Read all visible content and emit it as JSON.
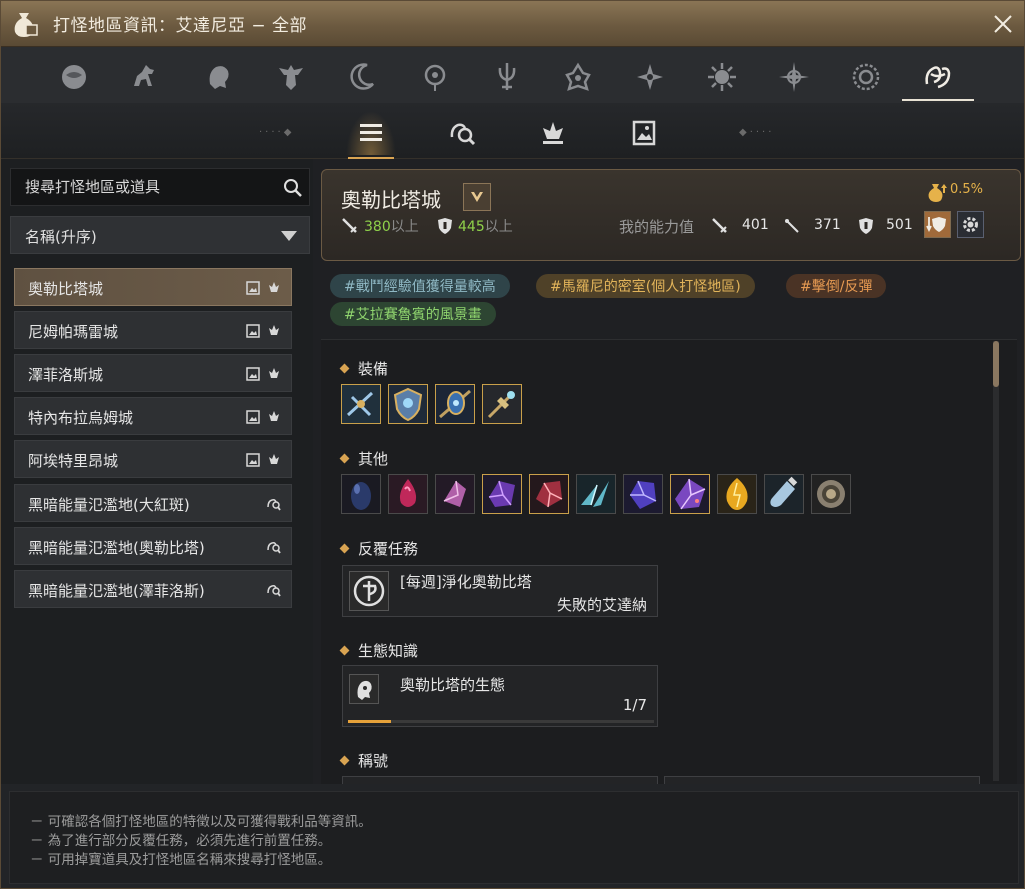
{
  "window": {
    "title": "打怪地區資訊：艾達尼亞 − 全部"
  },
  "region_tabs": [
    {
      "icon": "orb-emblem-icon"
    },
    {
      "icon": "horse-emblem-icon"
    },
    {
      "icon": "lion-emblem-icon"
    },
    {
      "icon": "eagle-emblem-icon"
    },
    {
      "icon": "crescent-emblem-icon"
    },
    {
      "icon": "eye-emblem-icon"
    },
    {
      "icon": "trident-emblem-icon"
    },
    {
      "icon": "flower-emblem-icon"
    },
    {
      "icon": "compass-emblem-icon"
    },
    {
      "icon": "sun-emblem-icon"
    },
    {
      "icon": "star-emblem-icon"
    },
    {
      "icon": "ring-emblem-icon"
    },
    {
      "icon": "all-regions-emblem-icon",
      "active": true
    }
  ],
  "sub_tabs": [
    {
      "icon": "list-icon",
      "active": true
    },
    {
      "icon": "monster-search-icon"
    },
    {
      "icon": "dungeon-crown-icon"
    },
    {
      "icon": "painting-icon"
    }
  ],
  "sidebar": {
    "search_placeholder": "搜尋打怪地區或道具",
    "sort_label": "名稱(升序)",
    "items": [
      {
        "name": "奧勒比塔城",
        "icons": [
          "painting-icon",
          "dungeon-crown-icon"
        ],
        "active": true
      },
      {
        "name": "尼姆帕瑪雷城",
        "icons": [
          "painting-icon",
          "dungeon-crown-icon"
        ]
      },
      {
        "name": "澤菲洛斯城",
        "icons": [
          "painting-icon",
          "dungeon-crown-icon"
        ]
      },
      {
        "name": "特內布拉烏姆城",
        "icons": [
          "painting-icon",
          "dungeon-crown-icon"
        ]
      },
      {
        "name": "阿埃特里昂城",
        "icons": [
          "painting-icon",
          "dungeon-crown-icon"
        ]
      },
      {
        "name": "黑暗能量氾濫地(大紅斑)",
        "icons": [
          "monster-search-icon"
        ]
      },
      {
        "name": "黑暗能量氾濫地(奧勒比塔)",
        "icons": [
          "monster-search-icon"
        ]
      },
      {
        "name": "黑暗能量氾濫地(澤菲洛斯)",
        "icons": [
          "monster-search-icon"
        ]
      }
    ]
  },
  "detail": {
    "name": "奧勒比塔城",
    "attack_req_value": "380",
    "attack_req_suffix": "以上",
    "defense_req_value": "445",
    "defense_req_suffix": "以上",
    "bonus": "0.5%",
    "my_stats_label": "我的能力值",
    "my_attack": "401",
    "my_accuracy": "371",
    "my_defense": "501",
    "tags": [
      {
        "text": "#戰鬥經驗值獲得量較高",
        "style": "teal"
      },
      {
        "text": "#馬羅尼的密室(個人打怪地區)",
        "style": "gold"
      },
      {
        "text": "#擊倒/反彈",
        "style": "orange"
      },
      {
        "text": "#艾拉賽魯賓的風景畫",
        "style": "green"
      }
    ],
    "sections": {
      "equipment_title": "裝備",
      "other_title": "其他",
      "repeat_quest_title": "反覆任務",
      "ecology_title": "生態知識",
      "title_title": "稱號"
    },
    "equipment_items": [
      "crossbow-item-icon",
      "shield-item-icon",
      "ornament-item-icon",
      "orb-staff-item-icon"
    ],
    "other_items": [
      "dark-egg-item-icon",
      "red-gem-item-icon",
      "pink-crystal-item-icon",
      "purple-crystal-item-icon",
      "red-crystal-item-icon",
      "teal-shard-item-icon",
      "violet-gem-item-icon",
      "amethyst-item-icon",
      "gold-egg-item-icon",
      "potion-item-icon",
      "medal-item-icon"
    ],
    "repeat_quest": {
      "title": "[每週]淨化奧勒比塔",
      "npc": "失敗的艾達納"
    },
    "ecology": {
      "title": "奧勒比塔的生態",
      "progress_text": "1/7",
      "progress": 0.14
    }
  },
  "footer": {
    "lines": [
      "－ 可確認各個打怪地區的特徵以及可獲得戰利品等資訊。",
      "－ 為了進行部分反覆任務，必須先進行前置任務。",
      "－ 可用掉寶道具及打怪地區名稱來搜尋打怪地區。"
    ]
  },
  "colors": {
    "accent": "#d9a452",
    "req_value": "#8fd14a",
    "bonus": "#e6b24a"
  }
}
